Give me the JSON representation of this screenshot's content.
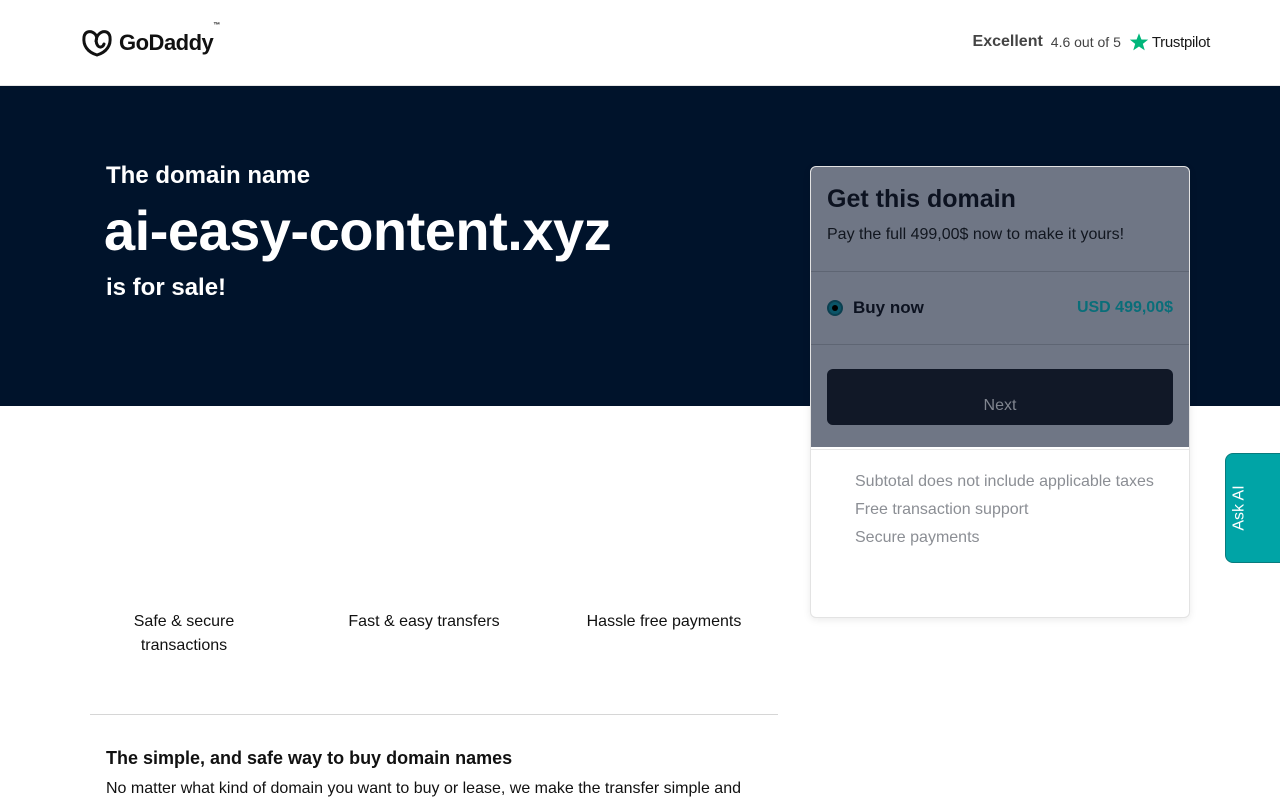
{
  "header": {
    "logo_text": "GoDaddy",
    "logo_tm": "™",
    "rating_word": "Excellent",
    "rating_score": "4.6 out of 5",
    "review_brand": "Trustpilot"
  },
  "hero": {
    "pre": "The domain name",
    "domain": "ai-easy-content.xyz",
    "post": "is for sale!"
  },
  "card": {
    "title": "Get this domain",
    "subtitle": "Pay the full 499,00$ now to make it yours!",
    "option_label": "Buy now",
    "option_price": "USD 499,00$",
    "next_label": "Next",
    "features": [
      "Subtotal does not include applicable taxes",
      "Free transaction support",
      "Secure payments"
    ]
  },
  "ask_ai": "Ask AI",
  "benefits": [
    "Safe & secure transactions",
    "Fast & easy transfers",
    "Hassle free payments"
  ],
  "section": {
    "title": "The simple, and safe way to buy domain names",
    "body": "No matter what kind of domain you want to buy or lease, we make the transfer simple and"
  },
  "colors": {
    "hero_bg": "#00132b",
    "accent_teal": "#00a4a6",
    "trustpilot_green": "#00b67a"
  },
  "icons": {
    "logo": "godaddy-logo-icon",
    "star": "trustpilot-star-icon"
  }
}
